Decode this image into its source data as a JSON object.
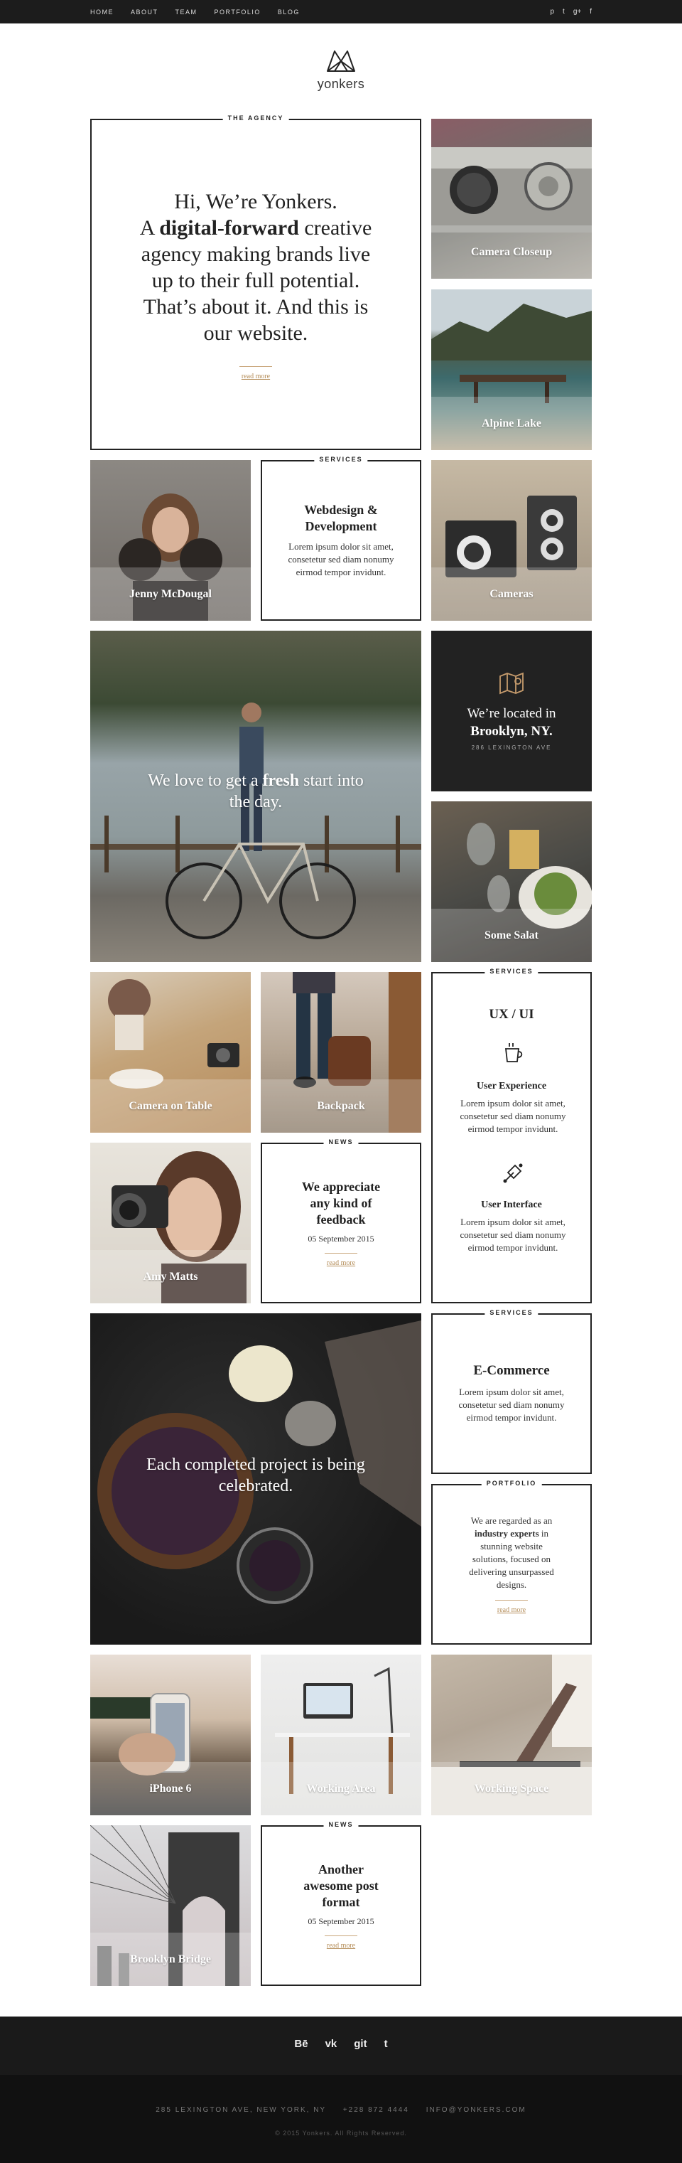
{
  "nav": {
    "items": [
      "HOME",
      "ABOUT",
      "TEAM",
      "PORTFOLIO",
      "BLOG"
    ],
    "social": [
      "p",
      "t",
      "g+",
      "f"
    ]
  },
  "brand": {
    "name": "yonkers"
  },
  "agency": {
    "label": "THE AGENCY",
    "line1": "Hi, We’re Yonkers.",
    "line2_a": "A ",
    "line2_b": "digital-forward",
    "line2_c": " creative",
    "line3": "agency making brands live",
    "line4": "up to their full potential.",
    "line5": "That’s about it. And this is",
    "line6": "our website.",
    "readmore": "read more"
  },
  "captions": {
    "camera_closeup": "Camera Closeup",
    "alpine_lake": "Alpine Lake",
    "jenny": "Jenny McDougal",
    "cameras": "Cameras",
    "some_salat": "Some Salat",
    "camera_table": "Camera on Table",
    "backpack": "Backpack",
    "amy": "Amy Matts",
    "iphone": "iPhone 6",
    "working_area": "Working Area",
    "working_space": "Working Space",
    "brooklyn": "Brooklyn Bridge"
  },
  "services1": {
    "label": "SERVICES",
    "title1": "Webdesign &",
    "title2": "Development",
    "text": "Lorem ipsum dolor sit amet, consetetur sed diam nonumy eirmod tempor invidunt."
  },
  "bike": {
    "line1_a": "We love to get a ",
    "line1_b": "fresh",
    "line1_c": " start into",
    "line2": "the day."
  },
  "location": {
    "line1": "We’re located in",
    "line2": "Brooklyn, NY.",
    "address": "286 LEXINGTON AVE"
  },
  "uxui": {
    "label": "SERVICES",
    "title": "UX / UI",
    "s1_title": "User Experience",
    "s1_text": "Lorem ipsum dolor sit amet, consetetur sed diam nonumy eirmod tempor invidunt.",
    "s2_title": "User Interface",
    "s2_text": "Lorem ipsum dolor sit amet, consetetur sed diam nonumy eirmod tempor invidunt."
  },
  "news1": {
    "label": "NEWS",
    "title1": "We appreciate",
    "title2": "any kind of",
    "title3": "feedback",
    "date": "05 September 2015",
    "readmore": "read more"
  },
  "pie": {
    "line1": "Each completed project is being",
    "line2": "celebrated."
  },
  "ecommerce": {
    "label": "SERVICES",
    "title": "E-Commerce",
    "text": "Lorem ipsum dolor sit amet, consetetur sed diam nonumy eirmod tempor invidunt."
  },
  "portfolio": {
    "label": "PORTFOLIO",
    "t1": "We are regarded as an",
    "t2": "industry experts",
    "t3": " in",
    "t4": "stunning website",
    "t5": "solutions, focused on",
    "t6": "delivering unsurpassed",
    "t7": "designs.",
    "readmore": "read more"
  },
  "news2": {
    "label": "NEWS",
    "title1": "Another",
    "title2": "awesome post",
    "title3": "format",
    "date": "05 September 2015",
    "readmore": "read more"
  },
  "footer": {
    "social": [
      "Bē",
      "vk",
      "git",
      "t"
    ],
    "address": "285 LEXINGTON AVE, NEW YORK, NY     +228 872 4444     INFO@YONKERS.COM",
    "copyright": "© 2015 Yonkers. All Rights Reserved."
  }
}
